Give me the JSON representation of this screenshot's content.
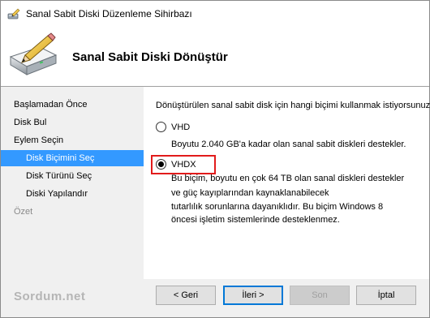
{
  "window": {
    "title": "Sanal Sabit Diski Düzenleme Sihirbazı"
  },
  "header": {
    "title": "Sanal Sabit Diski Dönüştür"
  },
  "nav": {
    "items": [
      {
        "label": "Başlamadan Önce"
      },
      {
        "label": "Disk Bul"
      },
      {
        "label": "Eylem Seçin"
      },
      {
        "label": "Disk Biçimini Seç"
      },
      {
        "label": "Disk Türünü Seç"
      },
      {
        "label": "Diski Yapılandır"
      },
      {
        "label": "Özet"
      }
    ]
  },
  "content": {
    "question": "Dönüştürülen sanal sabit disk için hangi biçimi kullanmak istiyorsunuz?",
    "options": [
      {
        "label": "VHD",
        "selected": false,
        "description": [
          "Boyutu 2.040 GB'a kadar olan sanal sabit diskleri destekler."
        ]
      },
      {
        "label": "VHDX",
        "selected": true,
        "description": [
          "Bu biçim, boyutu en çok 64 TB olan sanal diskleri destekler",
          "ve güç kayıplarından kaynaklanabilecek",
          "tutarlılık sorunlarına dayanıklıdır. Bu biçim Windows 8",
          "öncesi işletim sistemlerinde desteklenmez."
        ]
      }
    ]
  },
  "footer": {
    "watermark": "Sordum.net",
    "back_label": "< Geri",
    "next_label": "İleri >",
    "finish_label": "Son",
    "cancel_label": "İptal"
  },
  "colors": {
    "selection": "#3399ff",
    "highlight_box": "#e21b1b"
  }
}
